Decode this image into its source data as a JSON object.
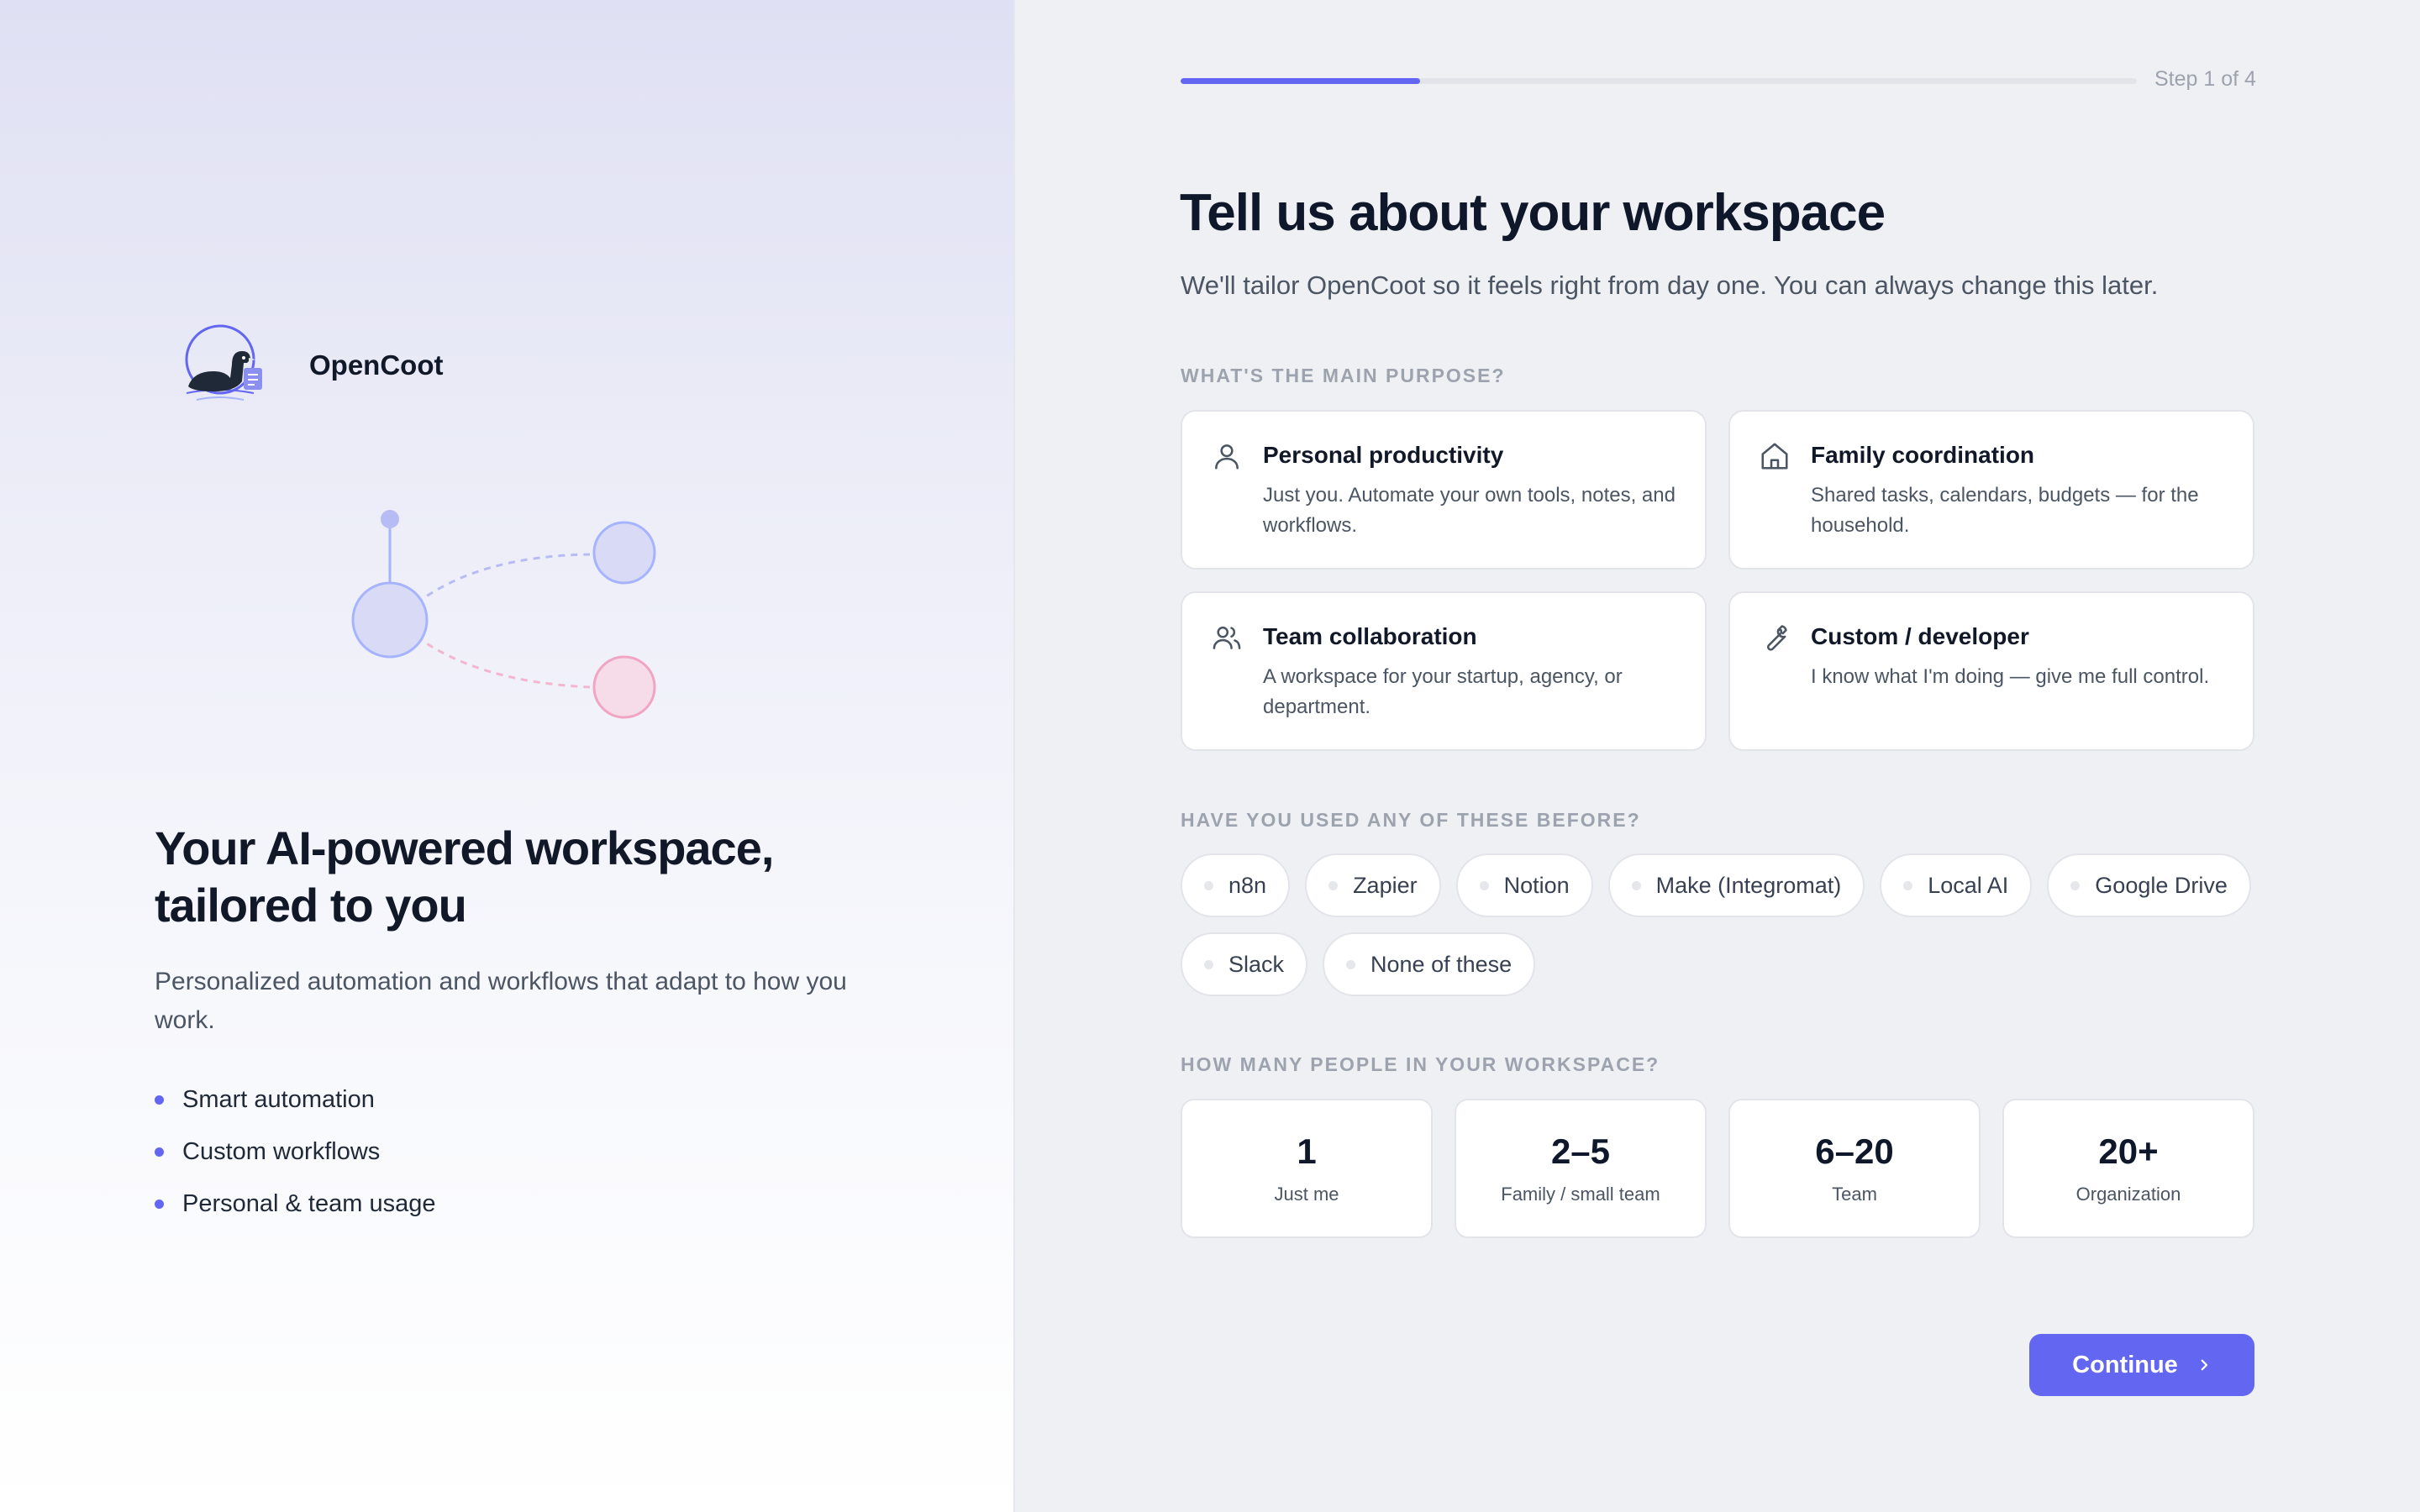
{
  "brand": {
    "name": "OpenCoot"
  },
  "hero": {
    "title": "Your AI-powered workspace, tailored to you",
    "subtitle": "Personalized automation and workflows that adapt to how you work.",
    "bullets": [
      "Smart automation",
      "Custom workflows",
      "Personal & team usage"
    ]
  },
  "progress": {
    "label": "Step 1 of 4",
    "fraction": 0.25
  },
  "page": {
    "title": "Tell us about your workspace",
    "subtitle": "We'll tailor OpenCoot so it feels right from day one. You can always change this later."
  },
  "purpose": {
    "label": "What's the main purpose?",
    "options": [
      {
        "icon": "person-icon",
        "title": "Personal productivity",
        "desc": "Just you. Automate your own tools, notes, and workflows."
      },
      {
        "icon": "home-icon",
        "title": "Family coordination",
        "desc": "Shared tasks, calendars, budgets — for the household."
      },
      {
        "icon": "users-icon",
        "title": "Team collaboration",
        "desc": "A workspace for your startup, agency, or department."
      },
      {
        "icon": "wrench-icon",
        "title": "Custom / developer",
        "desc": "I know what I'm doing — give me full control."
      }
    ]
  },
  "tools": {
    "label": "Have you used any of these before?",
    "options": [
      "n8n",
      "Zapier",
      "Notion",
      "Make (Integromat)",
      "Local AI",
      "Google Drive",
      "Slack",
      "None of these"
    ]
  },
  "size": {
    "label": "How many people in your workspace?",
    "options": [
      {
        "value": "1",
        "label": "Just me"
      },
      {
        "value": "2–5",
        "label": "Family / small team"
      },
      {
        "value": "6–20",
        "label": "Team"
      },
      {
        "value": "20+",
        "label": "Organization"
      }
    ]
  },
  "actions": {
    "continue": "Continue"
  },
  "colors": {
    "accent": "#6366f1",
    "accent_pink": "#f4b6cf",
    "node_fill": "#d9dbf6"
  }
}
